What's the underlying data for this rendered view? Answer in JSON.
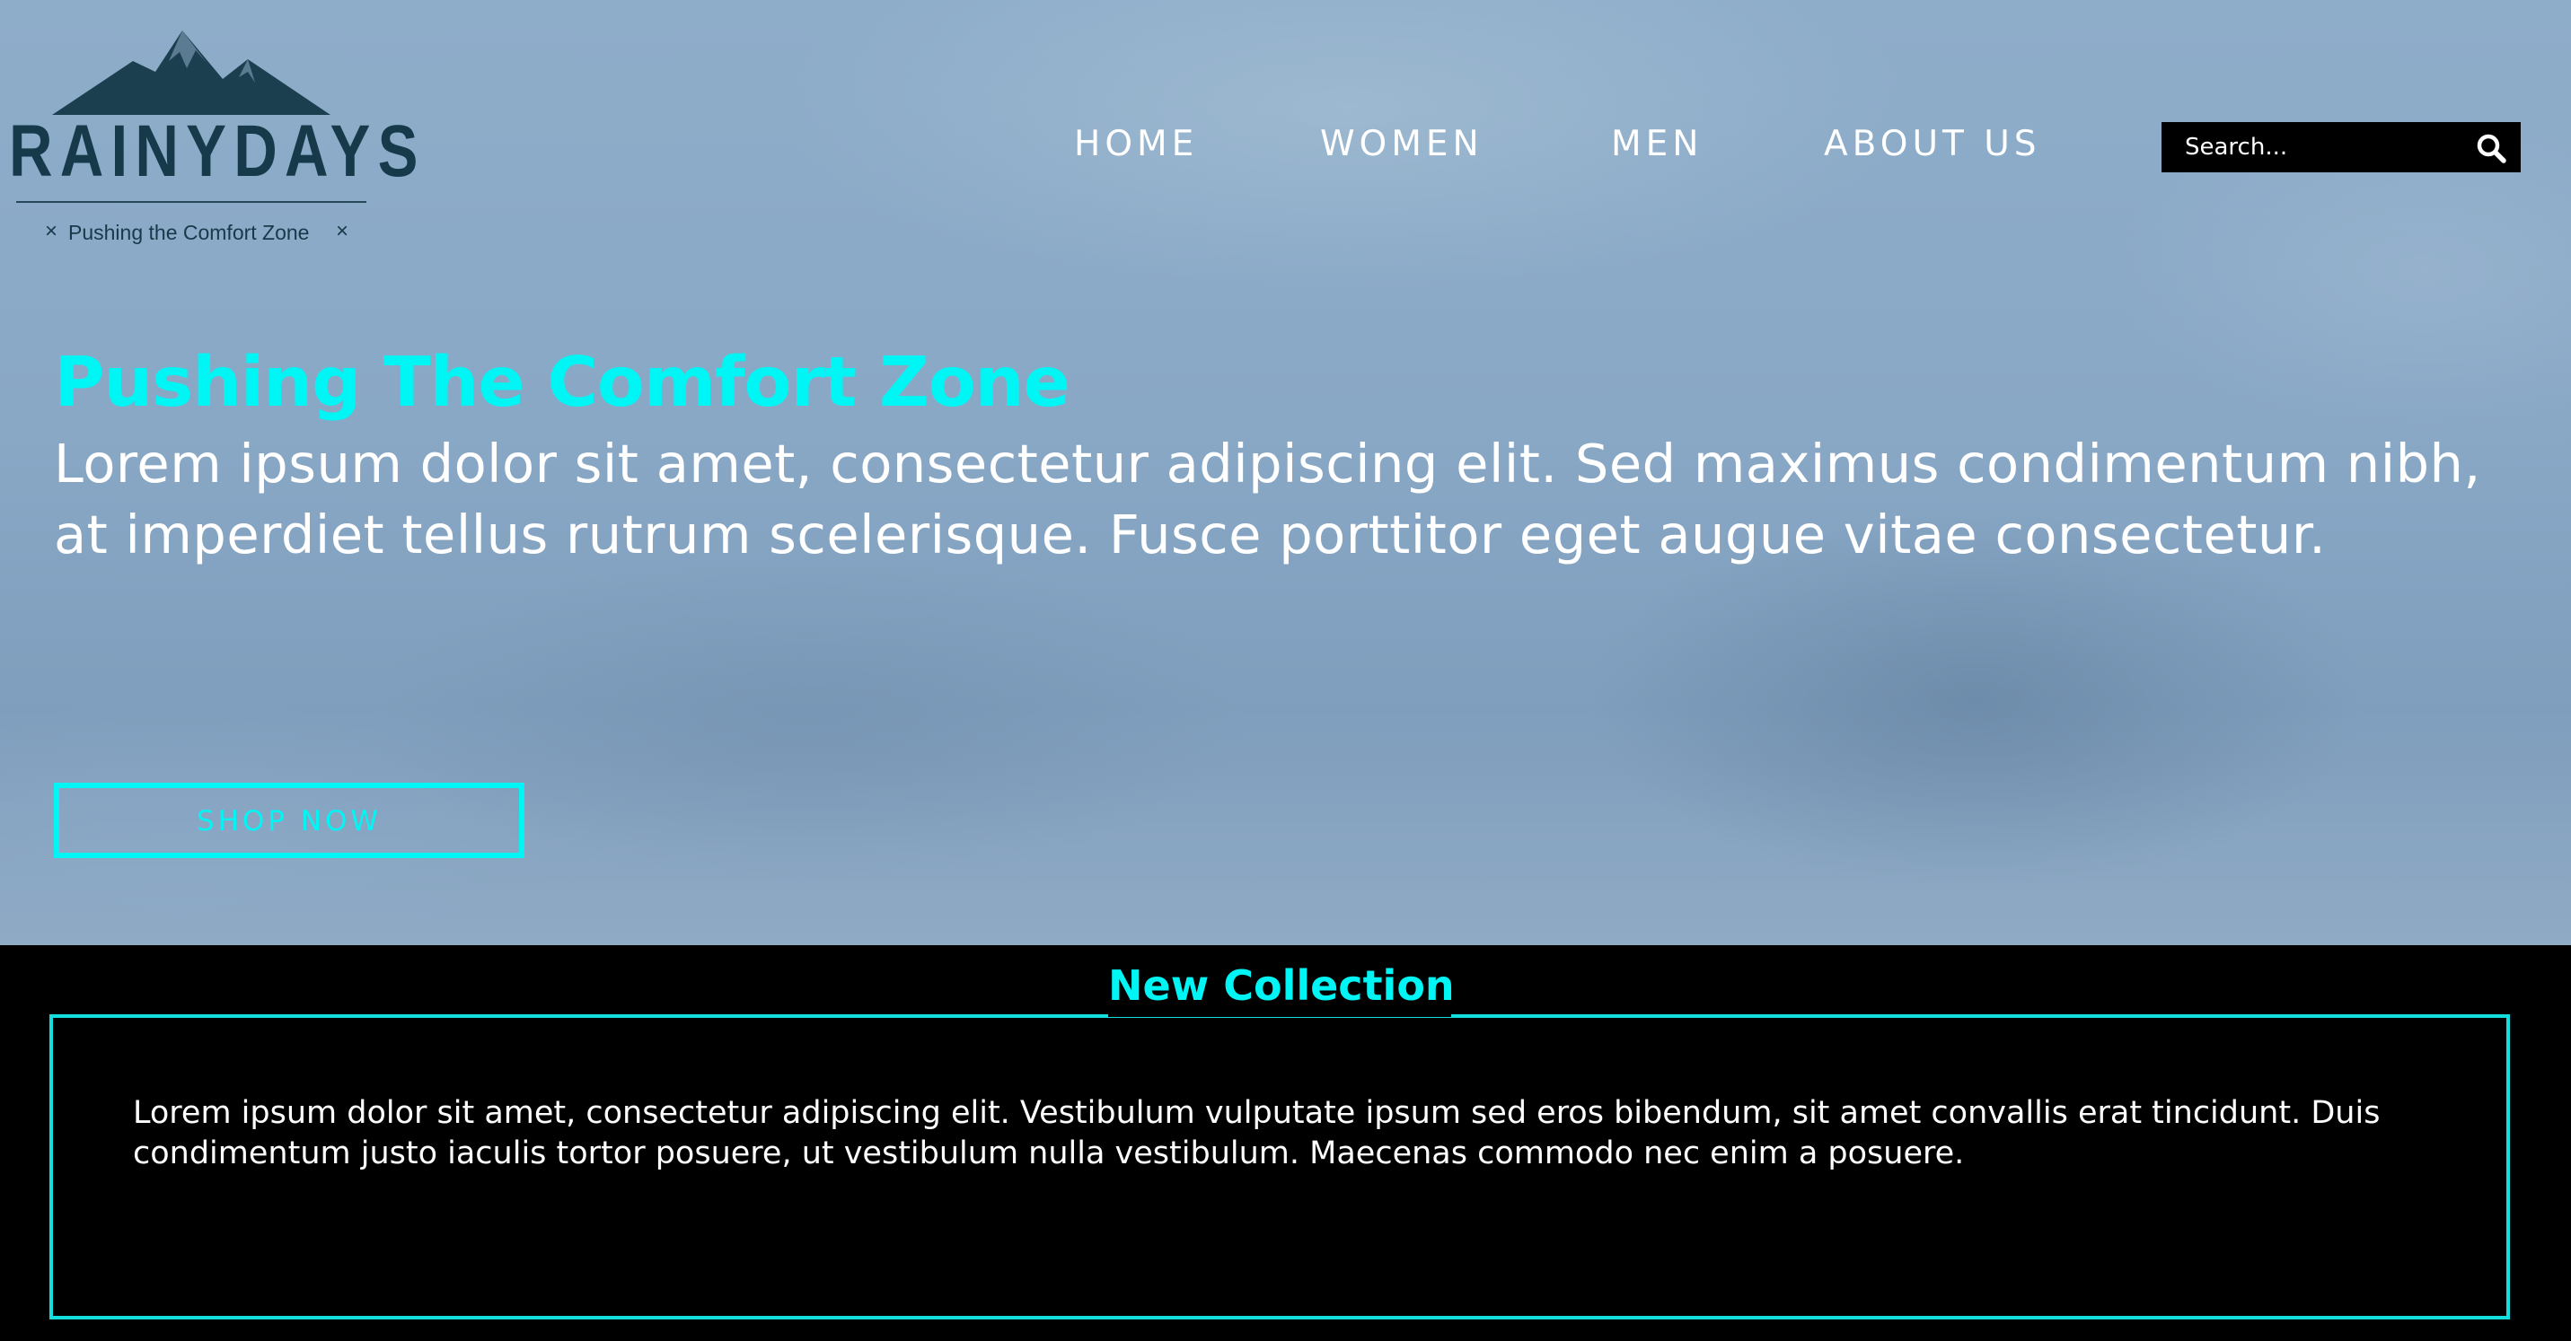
{
  "brand": {
    "name": "RAINYDAYS",
    "tagline": "Pushing the Comfort Zone",
    "tagline_marks": [
      "×",
      "×"
    ],
    "logo_icon": "mountain-icon",
    "color": "#163a4a"
  },
  "nav": {
    "items": [
      {
        "label": "HOME"
      },
      {
        "label": "WOMEN"
      },
      {
        "label": "MEN"
      },
      {
        "label": "ABOUT US"
      }
    ]
  },
  "search": {
    "placeholder": "Search...",
    "icon": "search-icon"
  },
  "hero": {
    "title": "Pushing The Comfort Zone",
    "text": "Lorem ipsum dolor sit amet, consectetur adipiscing elit. Sed maximus condimentum nibh, at imperdiet tellus rutrum scelerisque. Fusce porttitor eget augue vitae consectetur.",
    "cta_label": "SHOP NOW"
  },
  "collection": {
    "title": "New Collection",
    "text": "Lorem ipsum dolor sit amet, consectetur adipiscing elit. Vestibulum vulputate ipsum sed eros bibendum, sit amet convallis erat tincidunt. Duis condimentum justo iaculis tortor posuere, ut vestibulum nulla vestibulum. Maecenas commodo nec enim a posuere."
  },
  "colors": {
    "accent": "#00f5f5",
    "footer_bg": "#000000",
    "sky": "#8eadc9"
  }
}
